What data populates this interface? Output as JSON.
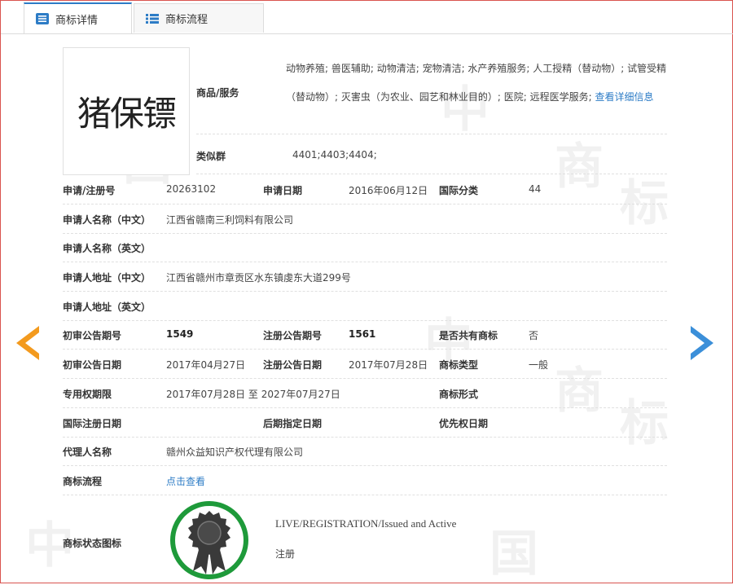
{
  "tabs": {
    "detail": "商标详情",
    "flow": "商标流程"
  },
  "trademark_image_text": "猪保镖",
  "fields": {
    "goods_label": "商品/服务",
    "goods_text": "动物养殖; 兽医辅助; 动物清洁; 宠物清洁; 水产养殖服务; 人工授精（替动物）; 试管受精（替动物）; 灭害虫（为农业、园艺和林业目的）; 医院; 远程医学服务;",
    "goods_more_link": "查看详细信息",
    "similar_group_label": "类似群",
    "similar_group_value": "4401;4403;4404;",
    "reg_no_label": "申请/注册号",
    "reg_no_value": "20263102",
    "apply_date_label": "申请日期",
    "apply_date_value": "2016年06月12日",
    "intl_class_label": "国际分类",
    "intl_class_value": "44",
    "applicant_cn_label": "申请人名称（中文）",
    "applicant_cn_value": "江西省赣南三利饲料有限公司",
    "applicant_en_label": "申请人名称（英文）",
    "address_cn_label": "申请人地址（中文）",
    "address_cn_value": "江西省赣州市章贡区水东镇虔东大道299号",
    "address_en_label": "申请人地址（英文）",
    "prelim_no_label": "初审公告期号",
    "prelim_no_value": "1549",
    "reg_pub_no_label": "注册公告期号",
    "reg_pub_no_value": "1561",
    "shared_label": "是否共有商标",
    "shared_value": "否",
    "prelim_date_label": "初审公告日期",
    "prelim_date_value": "2017年04月27日",
    "reg_pub_date_label": "注册公告日期",
    "reg_pub_date_value": "2017年07月28日",
    "tm_type_label": "商标类型",
    "tm_type_value": "一般",
    "exclusive_label": "专用权期限",
    "exclusive_value": "2017年07月28日 至 2027年07月27日",
    "tm_form_label": "商标形式",
    "intl_reg_date_label": "国际注册日期",
    "later_date_label": "后期指定日期",
    "priority_date_label": "优先权日期",
    "agent_label": "代理人名称",
    "agent_value": "赣州众益知识产权代理有限公司",
    "flow_label": "商标流程",
    "flow_link": "点击查看",
    "status_label": "商标状态图标",
    "status_en": "LIVE/REGISTRATION/Issued and Active",
    "status_cn": "注册"
  },
  "watermark": [
    "中",
    "国",
    "商",
    "标"
  ],
  "colors": {
    "accent": "#2d7cc6",
    "arrow_left": "#f39a1e",
    "arrow_right": "#3b8fd9",
    "seal_ring": "#1e9a3a"
  }
}
